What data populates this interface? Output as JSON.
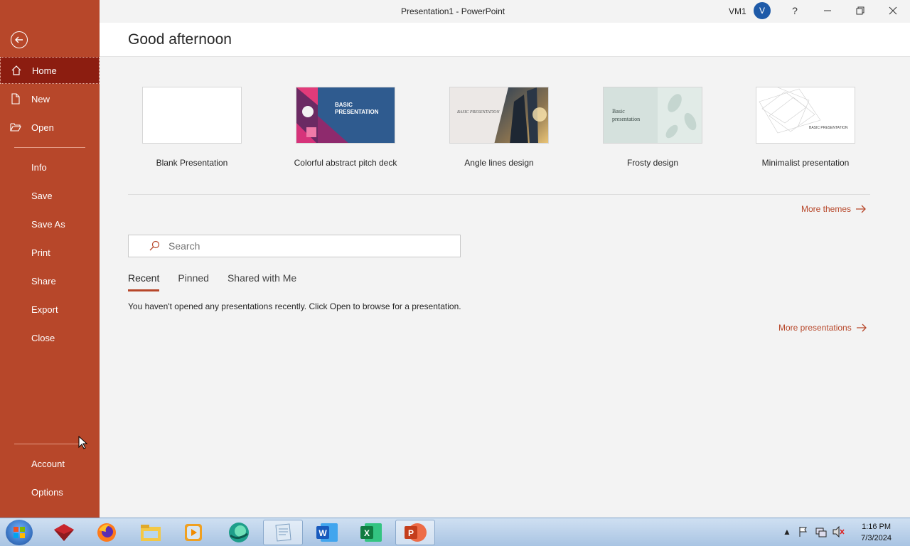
{
  "window": {
    "title": "Presentation1  -  PowerPoint",
    "user_name": "VM1",
    "avatar_letter": "V",
    "help": "?"
  },
  "sidebar": {
    "home": "Home",
    "new": "New",
    "open": "Open",
    "info": "Info",
    "save": "Save",
    "save_as": "Save As",
    "print": "Print",
    "share": "Share",
    "export": "Export",
    "close": "Close",
    "account": "Account",
    "options": "Options"
  },
  "greeting": "Good afternoon",
  "templates": {
    "blank": {
      "label": "Blank Presentation"
    },
    "colorful": {
      "label": "Colorful abstract pitch deck",
      "thumb_text": "BASIC PRESENTATION"
    },
    "angle": {
      "label": "Angle lines design",
      "thumb_text": "BASIC PRESENTATION"
    },
    "frosty": {
      "label": "Frosty design",
      "thumb_text": "Basic presentation"
    },
    "minimal": {
      "label": "Minimalist presentation",
      "thumb_text": "BASIC PRESENTATION"
    }
  },
  "more_themes": "More themes",
  "search": {
    "placeholder": "Search"
  },
  "tabs": {
    "recent": "Recent",
    "pinned": "Pinned",
    "shared": "Shared with Me"
  },
  "empty_message": "You haven't opened any presentations recently. Click Open to browse for a presentation.",
  "more_presentations": "More presentations",
  "taskbar": {
    "time": "1:16 PM",
    "date": "7/3/2024"
  },
  "colors": {
    "accent": "#b7472a",
    "sidebar_active": "#8c1d10"
  }
}
